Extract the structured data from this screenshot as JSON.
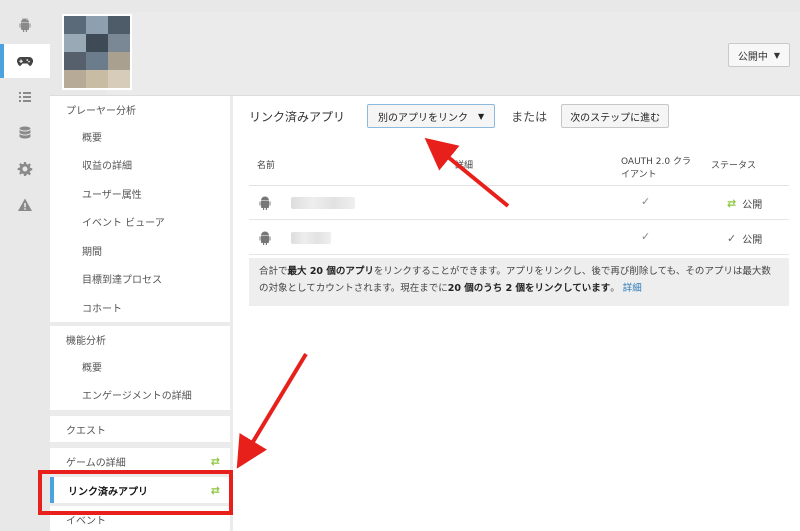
{
  "rail": {
    "items": [
      {
        "icon": "android-icon",
        "active": false
      },
      {
        "icon": "gamepad-icon",
        "active": true
      },
      {
        "icon": "list-icon",
        "active": false
      },
      {
        "icon": "database-icon",
        "active": false
      },
      {
        "icon": "gear-icon",
        "active": false
      },
      {
        "icon": "warning-icon",
        "active": false
      }
    ]
  },
  "header": {
    "publish_label": "公開中",
    "publish_caret": "▼"
  },
  "sidebar": {
    "group1": {
      "title": "プレーヤー分析",
      "items": [
        "概要",
        "収益の詳細",
        "ユーザー属性",
        "イベント ビューア",
        "期間",
        "目標到達プロセス",
        "コホート"
      ]
    },
    "group2": {
      "title": "機能分析",
      "items": [
        "概要",
        "エンゲージメントの詳細"
      ]
    },
    "quests": "クエスト",
    "game_details": "ゲームの詳細",
    "linked_apps": "リンク済みアプリ",
    "events": "イベント",
    "swap_glyph": "⇄"
  },
  "main": {
    "title": "リンク済みアプリ",
    "link_button": "別のアプリをリンク",
    "link_caret": "▼",
    "or_text": "または",
    "next_button": "次のステップに進む",
    "columns": {
      "name": "名前",
      "details": "詳細",
      "oauth_line1": "OAUTH 2.0 クラ",
      "oauth_line2": "イアント",
      "status": "ステータス"
    },
    "rows": [
      {
        "oauth": "✓",
        "status_icon": "⇄",
        "status_color": "#8dc63f",
        "status": "公開"
      },
      {
        "oauth": "✓",
        "status_icon": "✓",
        "status_color": "#666666",
        "status": "公開"
      }
    ],
    "note": {
      "p1": "合計で",
      "b1": "最大 20 個のアプリ",
      "p2": "をリンクすることができます。アプリをリンクし、後で再び削除しても、そのアプリは最大数の対象としてカウントされます。現在までに",
      "b2": "20 個のうち 2 個をリンクしています",
      "p3": "。",
      "link": "詳細"
    }
  },
  "colors": {
    "accent_blue": "#4aa3df",
    "annotation_red": "#e8201c",
    "swap_green": "#8dc63f"
  }
}
